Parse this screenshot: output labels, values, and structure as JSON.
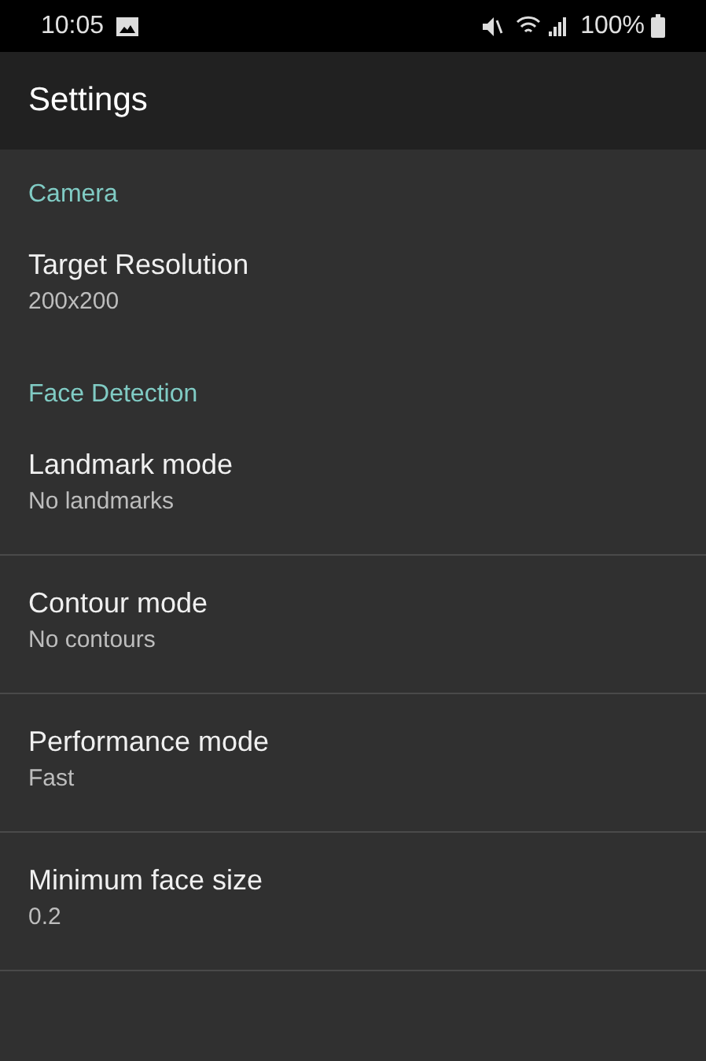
{
  "status_bar": {
    "time": "10:05",
    "battery": "100%"
  },
  "app_bar": {
    "title": "Settings"
  },
  "sections": [
    {
      "title": "Camera",
      "items": [
        {
          "title": "Target Resolution",
          "summary": "200x200",
          "divider": false
        }
      ]
    },
    {
      "title": "Face Detection",
      "items": [
        {
          "title": "Landmark mode",
          "summary": "No landmarks",
          "divider": true
        },
        {
          "title": "Contour mode",
          "summary": "No contours",
          "divider": true
        },
        {
          "title": "Performance mode",
          "summary": "Fast",
          "divider": true
        },
        {
          "title": "Minimum face size",
          "summary": "0.2",
          "divider": true
        }
      ]
    }
  ]
}
